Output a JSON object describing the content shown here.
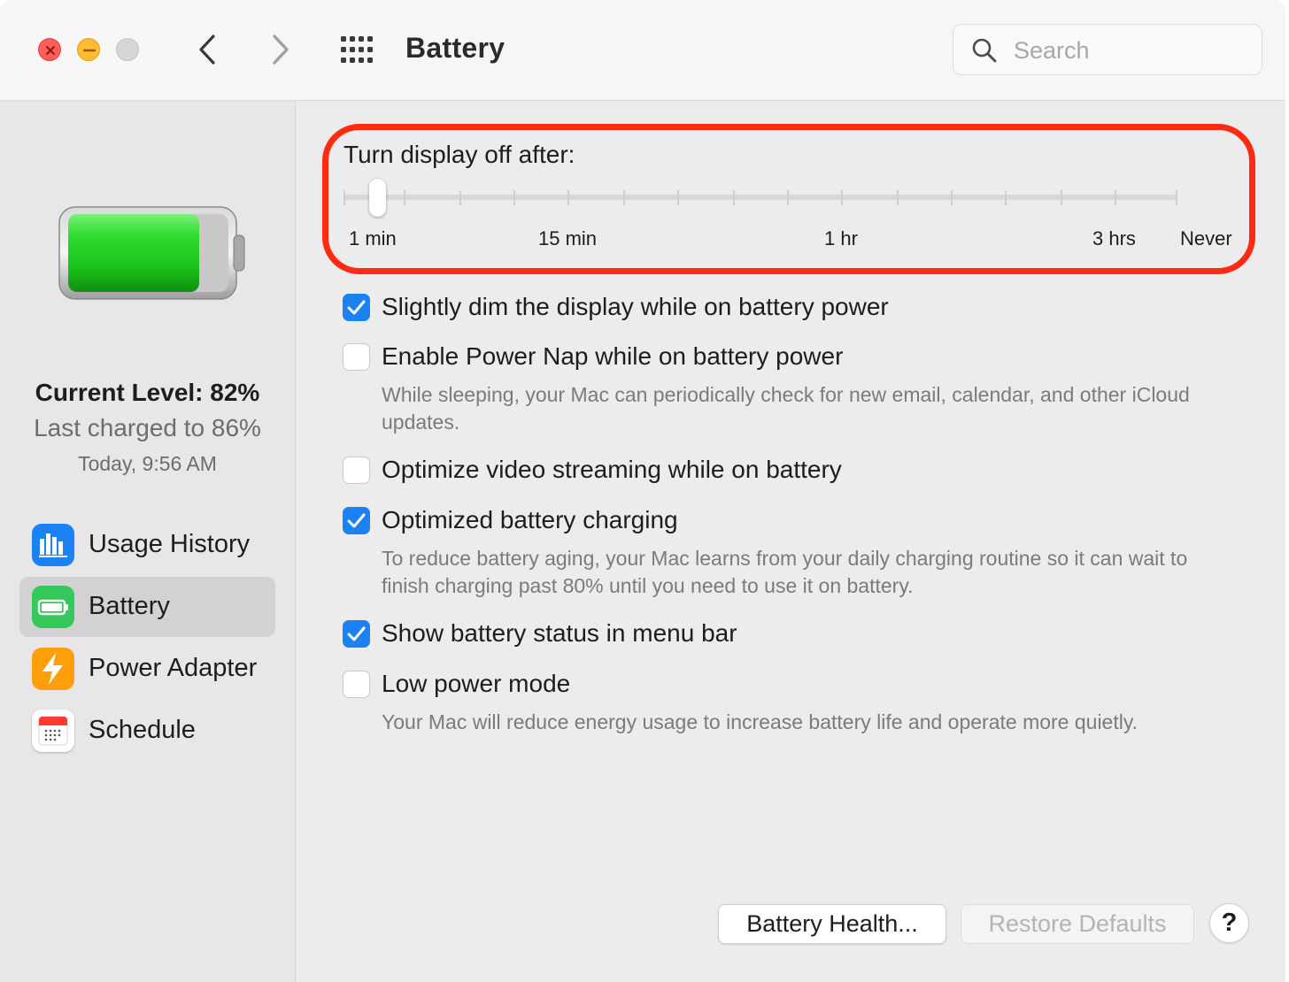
{
  "window": {
    "title": "Battery",
    "search": {
      "placeholder": "Search",
      "value": ""
    }
  },
  "sidebar": {
    "current_level": "Current Level: 82%",
    "last_charged": "Last charged to 86%",
    "charged_time": "Today, 9:56 AM",
    "battery_fill_fraction": 0.82,
    "items": [
      {
        "label": "Usage History",
        "icon": "chart-bars-icon",
        "color": "#1b82f4",
        "selected": false
      },
      {
        "label": "Battery",
        "icon": "battery-icon",
        "color": "#34c759",
        "selected": true
      },
      {
        "label": "Power Adapter",
        "icon": "lightning-bolt-icon",
        "color": "#ff9f0a",
        "selected": false
      },
      {
        "label": "Schedule",
        "icon": "calendar-icon",
        "color": "#ffffff",
        "selected": false
      }
    ]
  },
  "display_off": {
    "title": "Turn display off after:",
    "value": "1 min",
    "tick_labels": [
      "1 min",
      "15 min",
      "1 hr",
      "3 hrs",
      "Never"
    ],
    "annotation_color": "#ff2a12"
  },
  "options": [
    {
      "label": "Slightly dim the display while on battery power",
      "checked": true,
      "description": ""
    },
    {
      "label": "Enable Power Nap while on battery power",
      "checked": false,
      "description": "While sleeping, your Mac can periodically check for new email, calendar, and other iCloud updates."
    },
    {
      "label": "Optimize video streaming while on battery",
      "checked": false,
      "description": ""
    },
    {
      "label": "Optimized battery charging",
      "checked": true,
      "description": "To reduce battery aging, your Mac learns from your daily charging routine so it can wait to finish charging past 80% until you need to use it on battery."
    },
    {
      "label": "Show battery status in menu bar",
      "checked": true,
      "description": ""
    },
    {
      "label": "Low power mode",
      "checked": false,
      "description": "Your Mac will reduce energy usage to increase battery life and operate more quietly."
    }
  ],
  "buttons": {
    "battery_health": "Battery Health...",
    "restore_defaults": "Restore Defaults",
    "help": "?"
  },
  "colors": {
    "accent": "#1b82f4",
    "battery_green": "#2ecc2e"
  }
}
